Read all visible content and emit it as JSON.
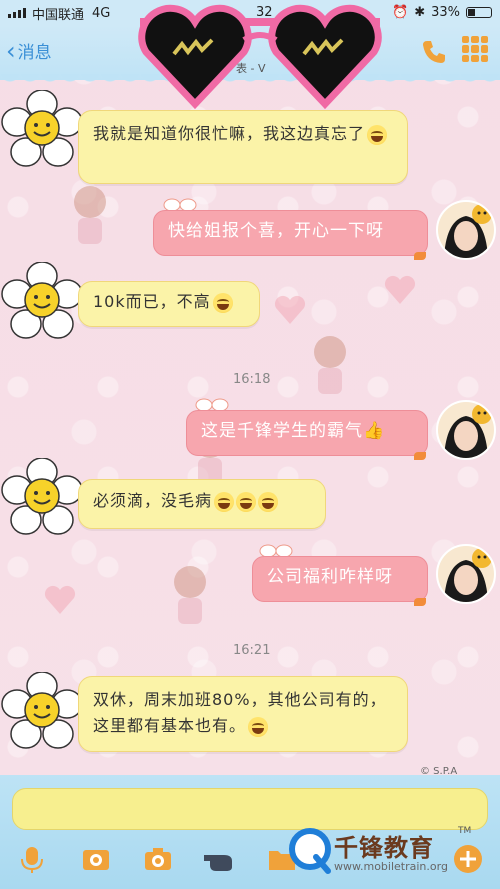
{
  "status_bar": {
    "carrier": "中国联通",
    "network": "4G",
    "time": "32",
    "battery": "33%"
  },
  "nav": {
    "back_label": "消息",
    "title": "表 - V"
  },
  "messages": [
    {
      "side": "left",
      "text": "我就是知道你很忙嘛，我这边真忘了"
    },
    {
      "side": "right",
      "text": "快给姐报个喜，开心一下呀"
    },
    {
      "side": "left",
      "text": "10k而已，不高"
    },
    {
      "side": "time",
      "text": "16:18"
    },
    {
      "side": "right",
      "text": "这是千锋学生的霸气"
    },
    {
      "side": "left",
      "text": "必须滴，没毛病"
    },
    {
      "side": "right",
      "text": "公司福利咋样呀"
    },
    {
      "side": "time",
      "text": "16:21"
    },
    {
      "side": "left",
      "text": "双休，周末加班80%，其他公司有的，这里都有基本也有。"
    }
  ],
  "copyright": "© S.P.A",
  "input": {
    "placeholder": ""
  },
  "watermark": {
    "name": "千锋教育",
    "url": "www.mobiletrain.org",
    "tm": "TM"
  },
  "icons": {
    "back": "chevron-left-icon",
    "phone": "phone-icon",
    "grid": "grid-icon",
    "voice": "microphone-icon",
    "image": "image-icon",
    "camera": "camera-icon",
    "pointer": "hand-icon",
    "folder": "folder-icon",
    "add": "plus-icon"
  },
  "colors": {
    "left_bubble": "#fbf3a8",
    "right_bubble": "#f7a6ae",
    "accent": "#3a8fd6"
  }
}
